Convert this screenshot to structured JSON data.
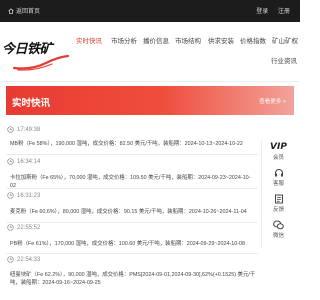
{
  "topbar": {
    "home_label": "返回首页",
    "login": "登录",
    "register": "注册"
  },
  "header": {
    "logo_text": "今日铁矿",
    "nav": [
      {
        "label": "实时快讯",
        "active": true
      },
      {
        "label": "市场分析",
        "active": false
      },
      {
        "label": "播价信息",
        "active": false
      },
      {
        "label": "市场结构",
        "active": false
      },
      {
        "label": "供求安装",
        "active": false
      },
      {
        "label": "价格指数",
        "active": false
      },
      {
        "label": "矿山矿权",
        "active": false
      },
      {
        "label": "行业资讯",
        "active": false
      }
    ]
  },
  "banner": {
    "title": "实时快讯",
    "more": "查看更多 >"
  },
  "news": [
    {
      "time": "17:49:38",
      "text": "MB粉（Fe 58%），190,000 湿吨，成交价格：82.50 美元/干吨，装船期：2024-10-13~2024-10-22"
    },
    {
      "time": "16:34:14",
      "text": "卡拉加斯粉（Fe 65%），70,000 湿吨，成交价格：109.50 美元/干吨，装船期：2024-09-23~2024-10-02"
    },
    {
      "time": "16:31:23",
      "text": "麦克粉（Fe 60.6%），80,000 湿吨，成交价格：90.15 美元/干吨，装船期：2024-10-26~2024-11-04"
    },
    {
      "time": "22:55:52",
      "text": "PB粉（Fe 61%），170,000 湿吨，成交价格：100.60 美元/干吨，装船期：2024-09-29~2024-10-08"
    },
    {
      "time": "22:54:33",
      "text": "纽曼块矿（Fe 62.2%），90,000 湿吨，成交价格：PMS[2024-09-01,2024-09-30],62%(+0.1525) 美元/干吨，装船期：2024-09-16~2024-09-25"
    }
  ],
  "sidebar": {
    "vip": "VIP",
    "vip_label": "会员",
    "service_label": "客服",
    "feedback_label": "反馈",
    "wechat_label": "微信"
  },
  "colors": {
    "accent": "#e23b32",
    "topbar": "#1c1c1c"
  }
}
